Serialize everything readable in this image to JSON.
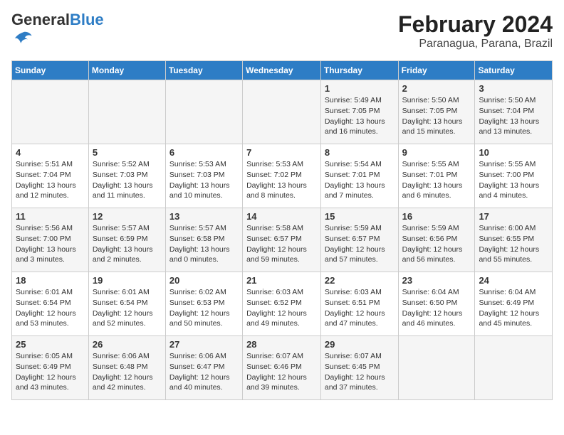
{
  "logo": {
    "general": "General",
    "blue": "Blue"
  },
  "title": "February 2024",
  "subtitle": "Paranagua, Parana, Brazil",
  "days_of_week": [
    "Sunday",
    "Monday",
    "Tuesday",
    "Wednesday",
    "Thursday",
    "Friday",
    "Saturday"
  ],
  "weeks": [
    [
      {
        "day": "",
        "info": ""
      },
      {
        "day": "",
        "info": ""
      },
      {
        "day": "",
        "info": ""
      },
      {
        "day": "",
        "info": ""
      },
      {
        "day": "1",
        "info": "Sunrise: 5:49 AM\nSunset: 7:05 PM\nDaylight: 13 hours\nand 16 minutes."
      },
      {
        "day": "2",
        "info": "Sunrise: 5:50 AM\nSunset: 7:05 PM\nDaylight: 13 hours\nand 15 minutes."
      },
      {
        "day": "3",
        "info": "Sunrise: 5:50 AM\nSunset: 7:04 PM\nDaylight: 13 hours\nand 13 minutes."
      }
    ],
    [
      {
        "day": "4",
        "info": "Sunrise: 5:51 AM\nSunset: 7:04 PM\nDaylight: 13 hours\nand 12 minutes."
      },
      {
        "day": "5",
        "info": "Sunrise: 5:52 AM\nSunset: 7:03 PM\nDaylight: 13 hours\nand 11 minutes."
      },
      {
        "day": "6",
        "info": "Sunrise: 5:53 AM\nSunset: 7:03 PM\nDaylight: 13 hours\nand 10 minutes."
      },
      {
        "day": "7",
        "info": "Sunrise: 5:53 AM\nSunset: 7:02 PM\nDaylight: 13 hours\nand 8 minutes."
      },
      {
        "day": "8",
        "info": "Sunrise: 5:54 AM\nSunset: 7:01 PM\nDaylight: 13 hours\nand 7 minutes."
      },
      {
        "day": "9",
        "info": "Sunrise: 5:55 AM\nSunset: 7:01 PM\nDaylight: 13 hours\nand 6 minutes."
      },
      {
        "day": "10",
        "info": "Sunrise: 5:55 AM\nSunset: 7:00 PM\nDaylight: 13 hours\nand 4 minutes."
      }
    ],
    [
      {
        "day": "11",
        "info": "Sunrise: 5:56 AM\nSunset: 7:00 PM\nDaylight: 13 hours\nand 3 minutes."
      },
      {
        "day": "12",
        "info": "Sunrise: 5:57 AM\nSunset: 6:59 PM\nDaylight: 13 hours\nand 2 minutes."
      },
      {
        "day": "13",
        "info": "Sunrise: 5:57 AM\nSunset: 6:58 PM\nDaylight: 13 hours\nand 0 minutes."
      },
      {
        "day": "14",
        "info": "Sunrise: 5:58 AM\nSunset: 6:57 PM\nDaylight: 12 hours\nand 59 minutes."
      },
      {
        "day": "15",
        "info": "Sunrise: 5:59 AM\nSunset: 6:57 PM\nDaylight: 12 hours\nand 57 minutes."
      },
      {
        "day": "16",
        "info": "Sunrise: 5:59 AM\nSunset: 6:56 PM\nDaylight: 12 hours\nand 56 minutes."
      },
      {
        "day": "17",
        "info": "Sunrise: 6:00 AM\nSunset: 6:55 PM\nDaylight: 12 hours\nand 55 minutes."
      }
    ],
    [
      {
        "day": "18",
        "info": "Sunrise: 6:01 AM\nSunset: 6:54 PM\nDaylight: 12 hours\nand 53 minutes."
      },
      {
        "day": "19",
        "info": "Sunrise: 6:01 AM\nSunset: 6:54 PM\nDaylight: 12 hours\nand 52 minutes."
      },
      {
        "day": "20",
        "info": "Sunrise: 6:02 AM\nSunset: 6:53 PM\nDaylight: 12 hours\nand 50 minutes."
      },
      {
        "day": "21",
        "info": "Sunrise: 6:03 AM\nSunset: 6:52 PM\nDaylight: 12 hours\nand 49 minutes."
      },
      {
        "day": "22",
        "info": "Sunrise: 6:03 AM\nSunset: 6:51 PM\nDaylight: 12 hours\nand 47 minutes."
      },
      {
        "day": "23",
        "info": "Sunrise: 6:04 AM\nSunset: 6:50 PM\nDaylight: 12 hours\nand 46 minutes."
      },
      {
        "day": "24",
        "info": "Sunrise: 6:04 AM\nSunset: 6:49 PM\nDaylight: 12 hours\nand 45 minutes."
      }
    ],
    [
      {
        "day": "25",
        "info": "Sunrise: 6:05 AM\nSunset: 6:49 PM\nDaylight: 12 hours\nand 43 minutes."
      },
      {
        "day": "26",
        "info": "Sunrise: 6:06 AM\nSunset: 6:48 PM\nDaylight: 12 hours\nand 42 minutes."
      },
      {
        "day": "27",
        "info": "Sunrise: 6:06 AM\nSunset: 6:47 PM\nDaylight: 12 hours\nand 40 minutes."
      },
      {
        "day": "28",
        "info": "Sunrise: 6:07 AM\nSunset: 6:46 PM\nDaylight: 12 hours\nand 39 minutes."
      },
      {
        "day": "29",
        "info": "Sunrise: 6:07 AM\nSunset: 6:45 PM\nDaylight: 12 hours\nand 37 minutes."
      },
      {
        "day": "",
        "info": ""
      },
      {
        "day": "",
        "info": ""
      }
    ]
  ]
}
